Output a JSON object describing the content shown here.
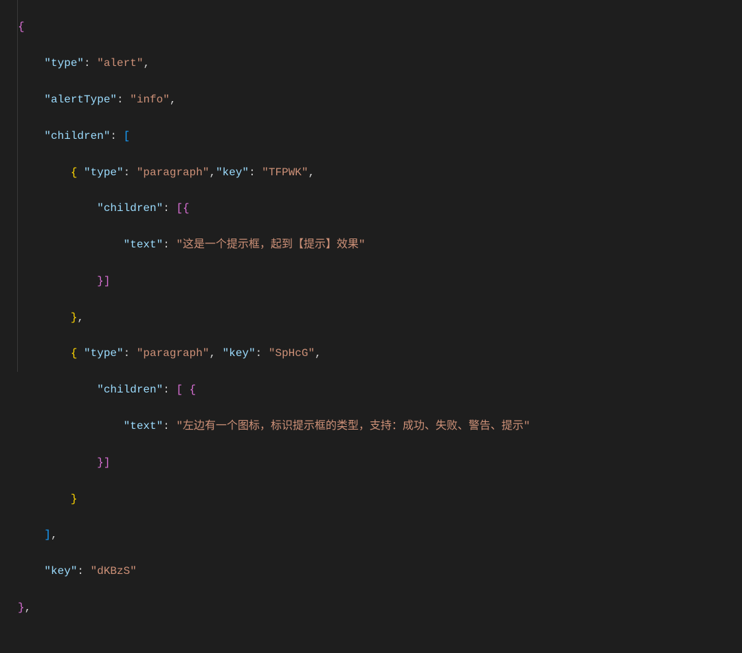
{
  "code": {
    "line1_brace": "{",
    "line2_key": "\"type\"",
    "line2_colon": ": ",
    "line2_val": "\"alert\"",
    "line2_comma": ",",
    "line3_key": "\"alertType\"",
    "line3_colon": ": ",
    "line3_val": "\"info\"",
    "line3_comma": ",",
    "line4_key": "\"children\"",
    "line4_colon": ": ",
    "line4_bracket": "[",
    "line5_brace": "{ ",
    "line5_key1": "\"type\"",
    "line5_colon1": ": ",
    "line5_val1": "\"paragraph\"",
    "line5_comma1": ",",
    "line5_key2": "\"key\"",
    "line5_colon2": ": ",
    "line5_val2": "\"TFPWK\"",
    "line5_comma2": ",",
    "line6_key": "\"children\"",
    "line6_colon": ": ",
    "line6_open": "[{",
    "line7_key": "\"text\"",
    "line7_colon": ": ",
    "line7_val": "\"这是一个提示框，起到【提示】效果\"",
    "line8_close": "}]",
    "line9_brace": "}",
    "line9_comma": ",",
    "line10_brace": "{ ",
    "line10_key1": "\"type\"",
    "line10_colon1": ": ",
    "line10_val1": "\"paragraph\"",
    "line10_comma1": ", ",
    "line10_key2": "\"key\"",
    "line10_colon2": ": ",
    "line10_val2": "\"SpHcG\"",
    "line10_comma2": ",",
    "line11_key": "\"children\"",
    "line11_colon": ": ",
    "line11_open": "[ {",
    "line12_key": "\"text\"",
    "line12_colon": ": ",
    "line12_val": "\"左边有一个图标，标识提示框的类型，支持：成功、失败、警告、提示\"",
    "line13_close": "}]",
    "line14_brace": "}",
    "line15_bracket": "]",
    "line15_comma": ",",
    "line16_key": "\"key\"",
    "line16_colon": ": ",
    "line16_val": "\"dKBzS\"",
    "line17_brace": "}",
    "line17_comma": ","
  }
}
